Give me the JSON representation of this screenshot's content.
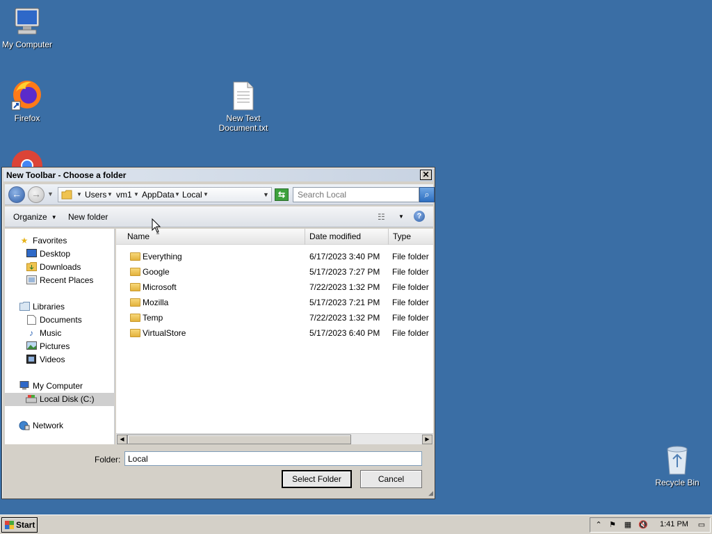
{
  "desktop": {
    "icons": [
      {
        "label": "My Computer"
      },
      {
        "label": "Firefox"
      },
      {
        "label": "New Text Document.txt"
      },
      {
        "label": "Recycle Bin"
      }
    ]
  },
  "dialog": {
    "title": "New Toolbar - Choose a folder",
    "close": "✕",
    "breadcrumbs": [
      "Users",
      "vm1",
      "AppData",
      "Local"
    ],
    "search_placeholder": "Search Local",
    "organize_label": "Organize",
    "new_folder_label": "New folder",
    "nav": {
      "favorites": "Favorites",
      "favorites_items": [
        "Desktop",
        "Downloads",
        "Recent Places"
      ],
      "libraries": "Libraries",
      "libraries_items": [
        "Documents",
        "Music",
        "Pictures",
        "Videos"
      ],
      "computer": "My Computer",
      "computer_items": [
        "Local Disk (C:)"
      ],
      "network": "Network"
    },
    "columns": [
      "Name",
      "Date modified",
      "Type"
    ],
    "files": [
      {
        "name": "Everything",
        "date": "6/17/2023 3:40 PM",
        "type": "File folder"
      },
      {
        "name": "Google",
        "date": "5/17/2023 7:27 PM",
        "type": "File folder"
      },
      {
        "name": "Microsoft",
        "date": "7/22/2023 1:32 PM",
        "type": "File folder"
      },
      {
        "name": "Mozilla",
        "date": "5/17/2023 7:21 PM",
        "type": "File folder"
      },
      {
        "name": "Temp",
        "date": "7/22/2023 1:32 PM",
        "type": "File folder"
      },
      {
        "name": "VirtualStore",
        "date": "5/17/2023 6:40 PM",
        "type": "File folder"
      }
    ],
    "folder_label": "Folder:",
    "folder_value": "Local",
    "select_button": "Select Folder",
    "cancel_button": "Cancel"
  },
  "taskbar": {
    "start_label": "Start",
    "clock": "1:41 PM"
  },
  "colors": {
    "desktop": "#3a6ea5",
    "selection": "#cfcfcf"
  }
}
